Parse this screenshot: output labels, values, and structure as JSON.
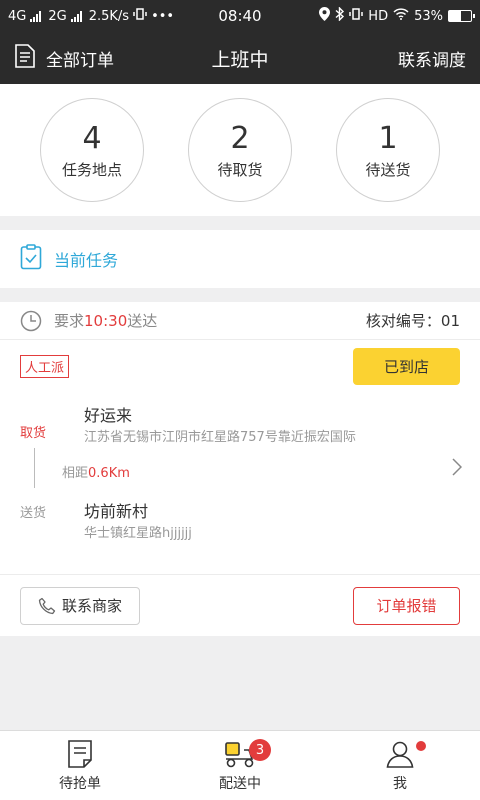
{
  "status_bar": {
    "net1": "4G",
    "net2": "2G",
    "speed": "2.5K/s",
    "more": "•••",
    "time": "08:40",
    "hd": "HD",
    "battery": "53%",
    "battery_level": 0.53
  },
  "header": {
    "all_orders": "全部订单",
    "title": "上班中",
    "contact": "联系调度"
  },
  "stats": [
    {
      "num": "4",
      "label": "任务地点"
    },
    {
      "num": "2",
      "label": "待取货"
    },
    {
      "num": "1",
      "label": "待送货"
    }
  ],
  "current_task": {
    "label": "当前任务"
  },
  "task": {
    "time_prefix": "要求",
    "time_value": "10:30",
    "time_suffix": "送达",
    "verify_label": "核对编号：",
    "verify_num": "01",
    "tag": "人工派",
    "arrived_button": "已到店",
    "pickup_label": "取货",
    "pickup_name": "好运来",
    "pickup_address": "江苏省无锡市江阴市红星路757号靠近振宏国际",
    "distance_prefix": "相距",
    "distance_value": "0.6Km",
    "delivery_label": "送货",
    "delivery_name": "坊前新村",
    "delivery_address": "华士镇红星路hjjjjjj",
    "contact_merchant": "联系商家",
    "report_error": "订单报错"
  },
  "tabbar": {
    "grab": "待抢单",
    "delivering": "配送中",
    "delivering_badge": "3",
    "me": "我"
  },
  "colors": {
    "accent_blue": "#2fa8d8",
    "red": "#e23c3c",
    "yellow": "#fbd231",
    "dark": "#2b2b2b"
  }
}
